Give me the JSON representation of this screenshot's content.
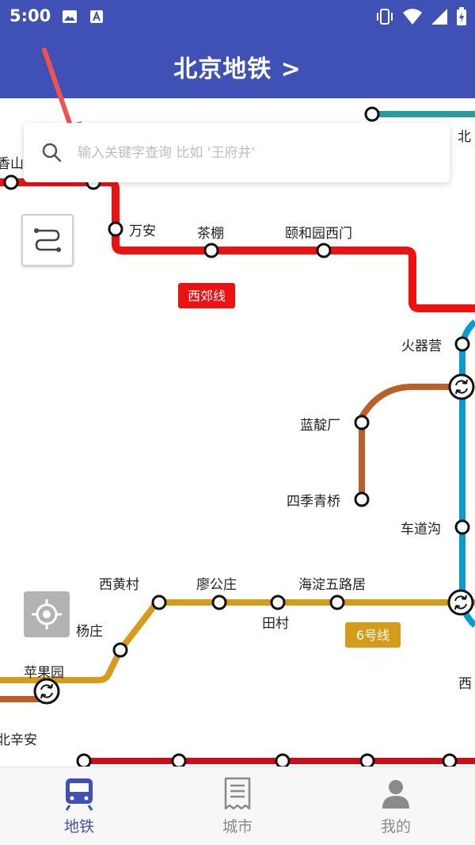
{
  "status_bar": {
    "time": "5:00"
  },
  "app_bar": {
    "title": "北京地铁 >"
  },
  "search": {
    "placeholder": "输入关键字查询 比如 '王府井'"
  },
  "lines": {
    "xijiao": {
      "name": "西郊线",
      "color": "#ee1111"
    },
    "line6": {
      "name": "6号线",
      "color": "#d79b1b"
    },
    "line10_color": "#0b9bd0",
    "brown_color": "#b85f2a",
    "teal_color": "#2a9a9a",
    "darkred_color": "#c8101a"
  },
  "stations": {
    "xiangshan": "香山",
    "wanan": "万安",
    "chapeng": "茶棚",
    "yiheyuanximen": "颐和园西门",
    "huoqiying": "火器营",
    "landianchang": "蓝靛厂",
    "sijiqingqiao": "四季青桥",
    "chedaogou": "车道沟",
    "xihuangcun": "西黄村",
    "liaogongzhuang": "廖公庄",
    "tiancun": "田村",
    "haidianwuluju": "海淀五路居",
    "yangzhuang": "杨庄",
    "pingguoyuan": "苹果园",
    "beixinan": "北辛安",
    "bei_partial": "北",
    "xi_partial": "西"
  },
  "bottom_nav": {
    "items": [
      {
        "label": "地铁",
        "active": true
      },
      {
        "label": "城市",
        "active": false
      },
      {
        "label": "我的",
        "active": false
      }
    ]
  },
  "colors": {
    "primary": "#3f51b5",
    "inactive": "#8a8a8a"
  }
}
